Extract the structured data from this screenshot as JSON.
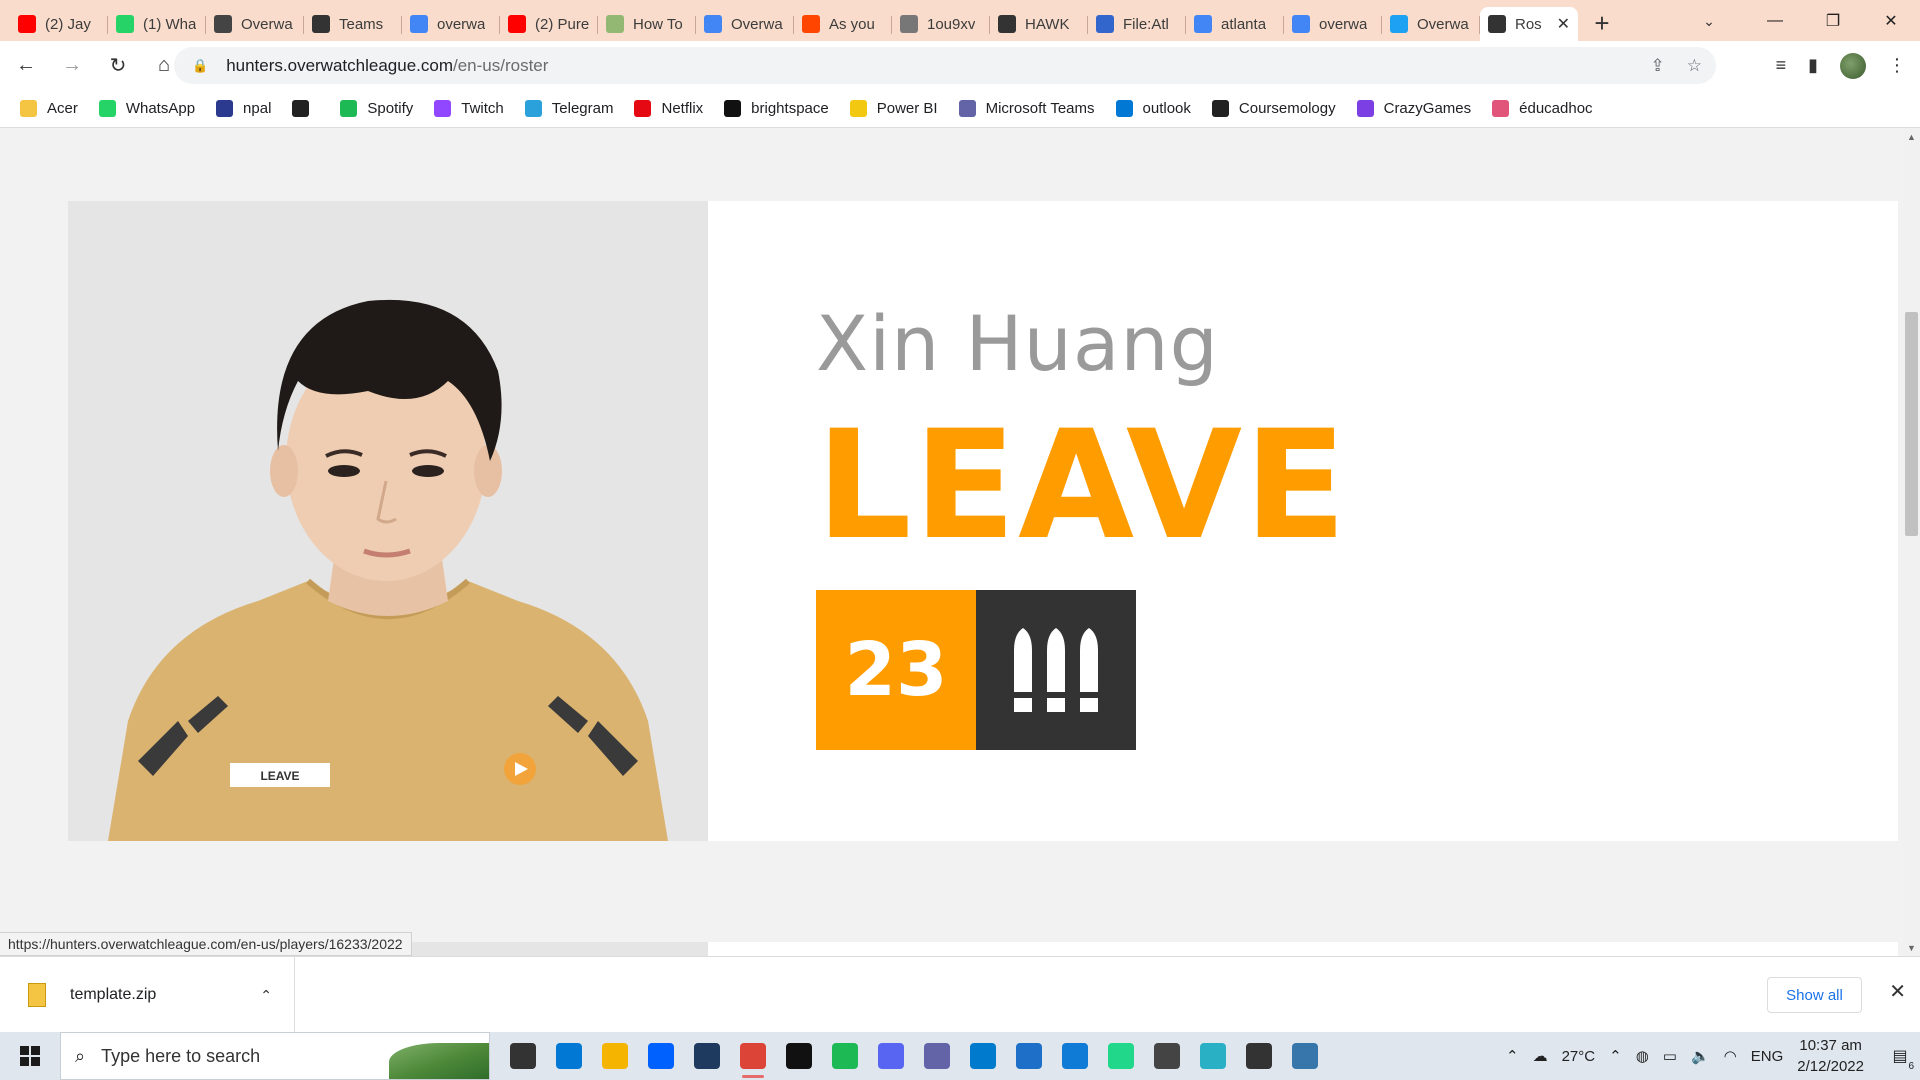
{
  "browser": {
    "tabs": [
      {
        "title": "(2) Jay",
        "icon": "youtube-icon",
        "color": "#ff0000"
      },
      {
        "title": "(1) Wha",
        "icon": "whatsapp-icon",
        "color": "#25d366"
      },
      {
        "title": "Overwa",
        "icon": "overwatch-icon",
        "color": "#444444"
      },
      {
        "title": "Teams",
        "icon": "team-logo-icon",
        "color": "#333333"
      },
      {
        "title": "overwa",
        "icon": "google-icon",
        "color": "#4285f4"
      },
      {
        "title": "(2) Pure",
        "icon": "youtube-icon",
        "color": "#ff0000"
      },
      {
        "title": "How To",
        "icon": "wikihow-icon",
        "color": "#93b874"
      },
      {
        "title": "Overwa",
        "icon": "google-icon",
        "color": "#4285f4"
      },
      {
        "title": "As you",
        "icon": "reddit-icon",
        "color": "#ff4500"
      },
      {
        "title": "1ou9xv",
        "icon": "globe-icon",
        "color": "#777777"
      },
      {
        "title": "HAWK",
        "icon": "team-logo-icon",
        "color": "#333333"
      },
      {
        "title": "File:Atl",
        "icon": "wiki-icon",
        "color": "#36c"
      },
      {
        "title": "atlanta",
        "icon": "google-icon",
        "color": "#4285f4"
      },
      {
        "title": "overwa",
        "icon": "google-icon",
        "color": "#4285f4"
      },
      {
        "title": "Overwa",
        "icon": "twitter-icon",
        "color": "#1da1f2"
      },
      {
        "title": "Ros",
        "icon": "team-logo-icon",
        "color": "#333333",
        "active": true
      }
    ],
    "url_host": "hunters.overwatchleague.com",
    "url_path": "/en-us/roster",
    "bookmarks": [
      {
        "label": "Acer",
        "icon": "folder-icon",
        "color": "#f4c542"
      },
      {
        "label": "WhatsApp",
        "icon": "whatsapp-icon",
        "color": "#25d366"
      },
      {
        "label": "npal",
        "icon": "npal-icon",
        "color": "#2b3a8f"
      },
      {
        "label": "",
        "icon": "globe-icon",
        "color": "#222222"
      },
      {
        "label": "Spotify",
        "icon": "spotify-icon",
        "color": "#1db954"
      },
      {
        "label": "Twitch",
        "icon": "twitch-icon",
        "color": "#9146ff"
      },
      {
        "label": "Telegram",
        "icon": "telegram-icon",
        "color": "#2aa1da"
      },
      {
        "label": "Netflix",
        "icon": "netflix-icon",
        "color": "#e50914"
      },
      {
        "label": "brightspace",
        "icon": "np-icon",
        "color": "#111111"
      },
      {
        "label": "Power BI",
        "icon": "powerbi-icon",
        "color": "#f2c811"
      },
      {
        "label": "Microsoft Teams",
        "icon": "teams-icon",
        "color": "#6264a7"
      },
      {
        "label": "outlook",
        "icon": "outlook-icon",
        "color": "#0078d4"
      },
      {
        "label": "Coursemology",
        "icon": "coursemology-icon",
        "color": "#222222"
      },
      {
        "label": "CrazyGames",
        "icon": "crazygames-icon",
        "color": "#7b3fe4"
      },
      {
        "label": "éducadhoc",
        "icon": "educadhoc-icon",
        "color": "#e2557a"
      }
    ],
    "status_url": "https://hunters.overwatchleague.com/en-us/players/16233/2022"
  },
  "player": {
    "name": "Xin Huang",
    "handle": "LEAVE",
    "number": "23",
    "role_icon": "damage-role-icon",
    "jersey_tag": "LEAVE",
    "accent": "#ff9c00",
    "dark": "#333333"
  },
  "downloads": {
    "file": "template.zip",
    "show_all": "Show all"
  },
  "taskbar": {
    "search_placeholder": "Type here to search",
    "apps": [
      {
        "icon": "task-view-icon",
        "color": "#333333"
      },
      {
        "icon": "mail-icon",
        "color": "#0078d4"
      },
      {
        "icon": "file-explorer-icon",
        "color": "#f4b400"
      },
      {
        "icon": "dropbox-icon",
        "color": "#0061ff"
      },
      {
        "icon": "store-icon",
        "color": "#1e3a5f"
      },
      {
        "icon": "chrome-icon",
        "color": "#db4437",
        "running": true
      },
      {
        "icon": "netflix-icon",
        "color": "#111111"
      },
      {
        "icon": "spotify-icon",
        "color": "#1db954"
      },
      {
        "icon": "discord-icon",
        "color": "#5865f2"
      },
      {
        "icon": "teams-icon",
        "color": "#6264a7"
      },
      {
        "icon": "vscode-icon",
        "color": "#007acc"
      },
      {
        "icon": "photos-icon",
        "color": "#1e6fc7"
      },
      {
        "icon": "edge-icon",
        "color": "#0f7bd6"
      },
      {
        "icon": "pycharm-icon",
        "color": "#21d789"
      },
      {
        "icon": "unity-icon",
        "color": "#444444"
      },
      {
        "icon": "maya-icon",
        "color": "#2ab0c5"
      },
      {
        "icon": "unity-hub-icon",
        "color": "#333333"
      },
      {
        "icon": "python-icon",
        "color": "#3776ab"
      }
    ],
    "temperature": "27°C",
    "language": "ENG",
    "time": "10:37 am",
    "date": "2/12/2022",
    "notification_count": "6"
  }
}
